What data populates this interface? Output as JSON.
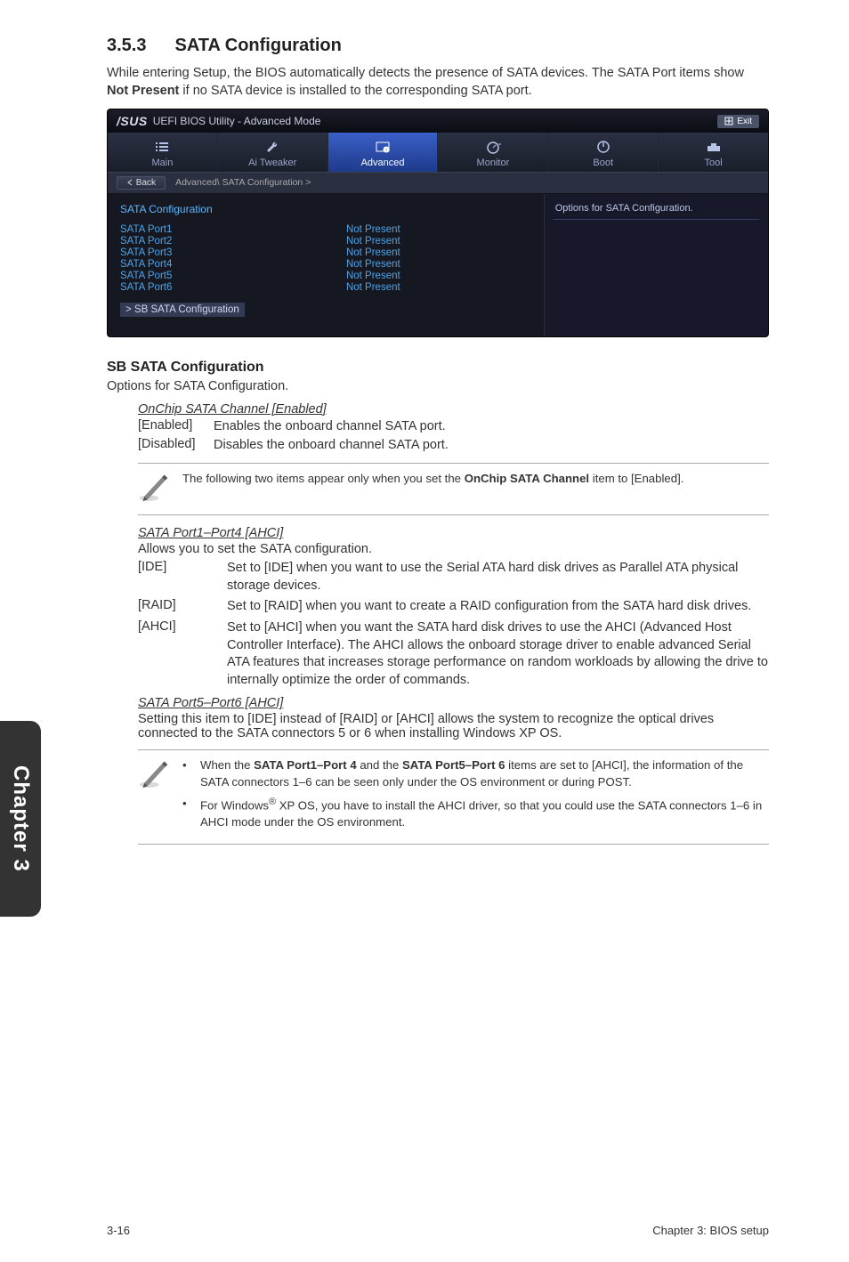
{
  "heading": {
    "num": "3.5.3",
    "title": "SATA Configuration"
  },
  "intro": "While entering Setup, the BIOS automatically detects the presence of SATA devices. The SATA Port items show Not Present if no SATA device is installed to the corresponding SATA port.",
  "bios": {
    "brand": "/SUS",
    "title": "UEFI BIOS Utility - Advanced Mode",
    "exit": "Exit",
    "tabs": [
      "Main",
      "Ai Tweaker",
      "Advanced",
      "Monitor",
      "Boot",
      "Tool"
    ],
    "back": "Back",
    "breadcrumb": "Advanced\\ SATA Configuration  >",
    "panel_title": "SATA Configuration",
    "rows": [
      {
        "k": "SATA Port1",
        "v": "Not Present"
      },
      {
        "k": "SATA Port2",
        "v": "Not Present"
      },
      {
        "k": "SATA Port3",
        "v": "Not Present"
      },
      {
        "k": "SATA Port4",
        "v": "Not Present"
      },
      {
        "k": "SATA Port5",
        "v": "Not Present"
      },
      {
        "k": "SATA Port6",
        "v": "Not Present"
      }
    ],
    "link": "SB SATA Configuration",
    "side_info": "Options for SATA Configuration."
  },
  "sb_heading": "SB SATA Configuration",
  "sb_text": "Options for SATA Configuration.",
  "onchip": {
    "title": "OnChip SATA Channel [Enabled]",
    "rows": [
      {
        "k": "[Enabled]",
        "v": "Enables the onboard channel SATA port."
      },
      {
        "k": "[Disabled]",
        "v": "Disables the onboard channel SATA port."
      }
    ]
  },
  "note1_pre": "The following two items appear only when you set the ",
  "note1_bold": "OnChip SATA Channel",
  "note1_post": " item to [Enabled].",
  "p14": {
    "title": "SATA Port1–Port4 [AHCI]",
    "intro": "Allows you to set the SATA configuration.",
    "rows": [
      {
        "k": "[IDE]",
        "v": "Set to [IDE] when you want to use the Serial ATA hard disk drives as Parallel ATA physical storage devices."
      },
      {
        "k": "[RAID]",
        "v": "Set to [RAID] when you want to create a RAID configuration from the SATA hard disk drives."
      },
      {
        "k": "[AHCI]",
        "v": "Set to [AHCI] when you want the SATA hard disk drives to use the AHCI (Advanced Host Controller Interface). The AHCI allows the onboard storage driver to enable advanced Serial ATA features that increases storage performance on random workloads by allowing the drive to internally optimize the order of commands."
      }
    ]
  },
  "p56": {
    "title": "SATA Port5–Port6 [AHCI]",
    "text": "Setting this item to [IDE] instead of [RAID] or [AHCI] allows the system to recognize the optical drives connected to the SATA connectors 5 or 6 when installing Windows XP OS."
  },
  "note2_b1_pre": "When the ",
  "note2_b1_bold1": "SATA Port1–Port 4",
  "note2_b1_mid": " and the ",
  "note2_b1_bold2": "SATA Port5–Port 6",
  "note2_b1_post": " items are set to [AHCI], the information of the SATA connectors 1–6 can be seen only under the OS environment or during POST.",
  "note2_b2_pre": "For Windows",
  "note2_b2_sup": "®",
  "note2_b2_post": " XP OS, you have to install the AHCI driver, so that you could use the SATA connectors 1–6 in AHCI mode under the OS environment.",
  "sidetab": "Chapter 3",
  "footer_left": "3-16",
  "footer_right": "Chapter 3: BIOS setup"
}
